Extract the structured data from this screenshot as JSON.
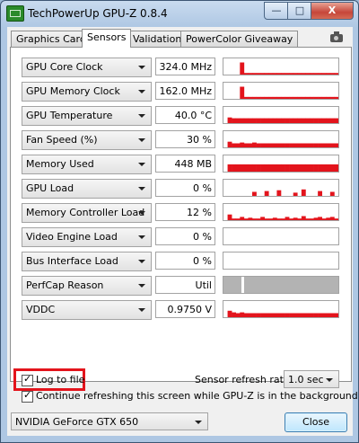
{
  "window": {
    "title": "TechPowerUp GPU-Z 0.8.4",
    "minimize": "—",
    "maximize": "□",
    "close": "X"
  },
  "tabs": [
    "Graphics Card",
    "Sensors",
    "Validation",
    "PowerColor Giveaway"
  ],
  "active_tab": "Sensors",
  "sensors": [
    {
      "label": "GPU Core Clock",
      "value": "324.0 MHz",
      "graph": [
        0,
        0,
        0,
        0,
        0.75,
        0.1,
        0.1,
        0.1,
        0.1,
        0.1,
        0.1,
        0.1,
        0.1,
        0.1,
        0.1,
        0.1,
        0.1,
        0.1,
        0.1,
        0.1,
        0.1,
        0.1,
        0.1,
        0.1,
        0.1,
        0.1,
        0.1,
        0.1
      ]
    },
    {
      "label": "GPU Memory Clock",
      "value": "162.0 MHz",
      "graph": [
        0,
        0,
        0,
        0,
        0.75,
        0.12,
        0.12,
        0.12,
        0.12,
        0.12,
        0.12,
        0.12,
        0.12,
        0.12,
        0.12,
        0.12,
        0.12,
        0.12,
        0.12,
        0.12,
        0.12,
        0.12,
        0.12,
        0.12,
        0.12,
        0.12,
        0.12,
        0.12
      ]
    },
    {
      "label": "GPU Temperature",
      "value": "40.0 °C",
      "graph": [
        0,
        0.35,
        0.3,
        0.3,
        0.3,
        0.3,
        0.3,
        0.3,
        0.3,
        0.3,
        0.3,
        0.3,
        0.3,
        0.3,
        0.3,
        0.3,
        0.3,
        0.3,
        0.3,
        0.3,
        0.3,
        0.3,
        0.3,
        0.3,
        0.3,
        0.3,
        0.3,
        0.3
      ]
    },
    {
      "label": "Fan Speed (%)",
      "value": "30 %",
      "graph": [
        0,
        0.35,
        0.25,
        0.25,
        0.3,
        0.25,
        0.25,
        0.3,
        0.25,
        0.25,
        0.25,
        0.25,
        0.25,
        0.25,
        0.25,
        0.25,
        0.25,
        0.25,
        0.25,
        0.25,
        0.25,
        0.25,
        0.25,
        0.25,
        0.25,
        0.25,
        0.25,
        0.25
      ]
    },
    {
      "label": "Memory Used",
      "value": "448 MB",
      "graph": [
        0,
        0.45,
        0.45,
        0.45,
        0.45,
        0.45,
        0.45,
        0.45,
        0.45,
        0.45,
        0.45,
        0.45,
        0.45,
        0.45,
        0.45,
        0.45,
        0.45,
        0.45,
        0.45,
        0.45,
        0.45,
        0.45,
        0.45,
        0.45,
        0.45,
        0.45,
        0.45,
        0.45
      ]
    },
    {
      "label": "GPU Load",
      "value": "0 %",
      "graph": [
        0,
        0,
        0,
        0,
        0,
        0,
        0,
        0.25,
        0,
        0,
        0.3,
        0,
        0,
        0.35,
        0,
        0,
        0,
        0.2,
        0,
        0.4,
        0,
        0,
        0,
        0.3,
        0,
        0,
        0.25,
        0
      ]
    },
    {
      "label": "Memory Controller Load",
      "value": "12 %",
      "graph": [
        0,
        0.35,
        0.1,
        0.1,
        0.2,
        0.1,
        0.15,
        0.1,
        0.1,
        0.2,
        0.1,
        0.1,
        0.15,
        0.1,
        0.1,
        0.2,
        0.1,
        0.15,
        0.1,
        0.25,
        0.1,
        0.1,
        0.15,
        0.2,
        0.1,
        0.15,
        0.2,
        0.1
      ]
    },
    {
      "label": "Video Engine Load",
      "value": "0 %",
      "graph": []
    },
    {
      "label": "Bus Interface Load",
      "value": "0 %",
      "graph": []
    },
    {
      "label": "PerfCap Reason",
      "value": "Util",
      "graph": []
    },
    {
      "label": "VDDC",
      "value": "0.9750 V",
      "graph": [
        0,
        0.4,
        0.3,
        0.25,
        0.3,
        0.25,
        0.25,
        0.25,
        0.25,
        0.25,
        0.25,
        0.25,
        0.25,
        0.25,
        0.25,
        0.25,
        0.25,
        0.25,
        0.25,
        0.25,
        0.25,
        0.25,
        0.25,
        0.25,
        0.25,
        0.25,
        0.25,
        0.25
      ]
    }
  ],
  "graph_color": "#e3141c",
  "perfcap_color": "#b3b3b3",
  "highlight_color": "#e3141c",
  "log_to_file": {
    "label": "Log to file",
    "checked": true
  },
  "refresh": {
    "label": "Sensor refresh rate:",
    "value": "1.0 sec"
  },
  "continue_refresh": {
    "label": "Continue refreshing this screen while GPU-Z is in the background",
    "checked": true
  },
  "gpu_select": {
    "value": "NVIDIA GeForce GTX 650"
  },
  "close_button": "Close"
}
